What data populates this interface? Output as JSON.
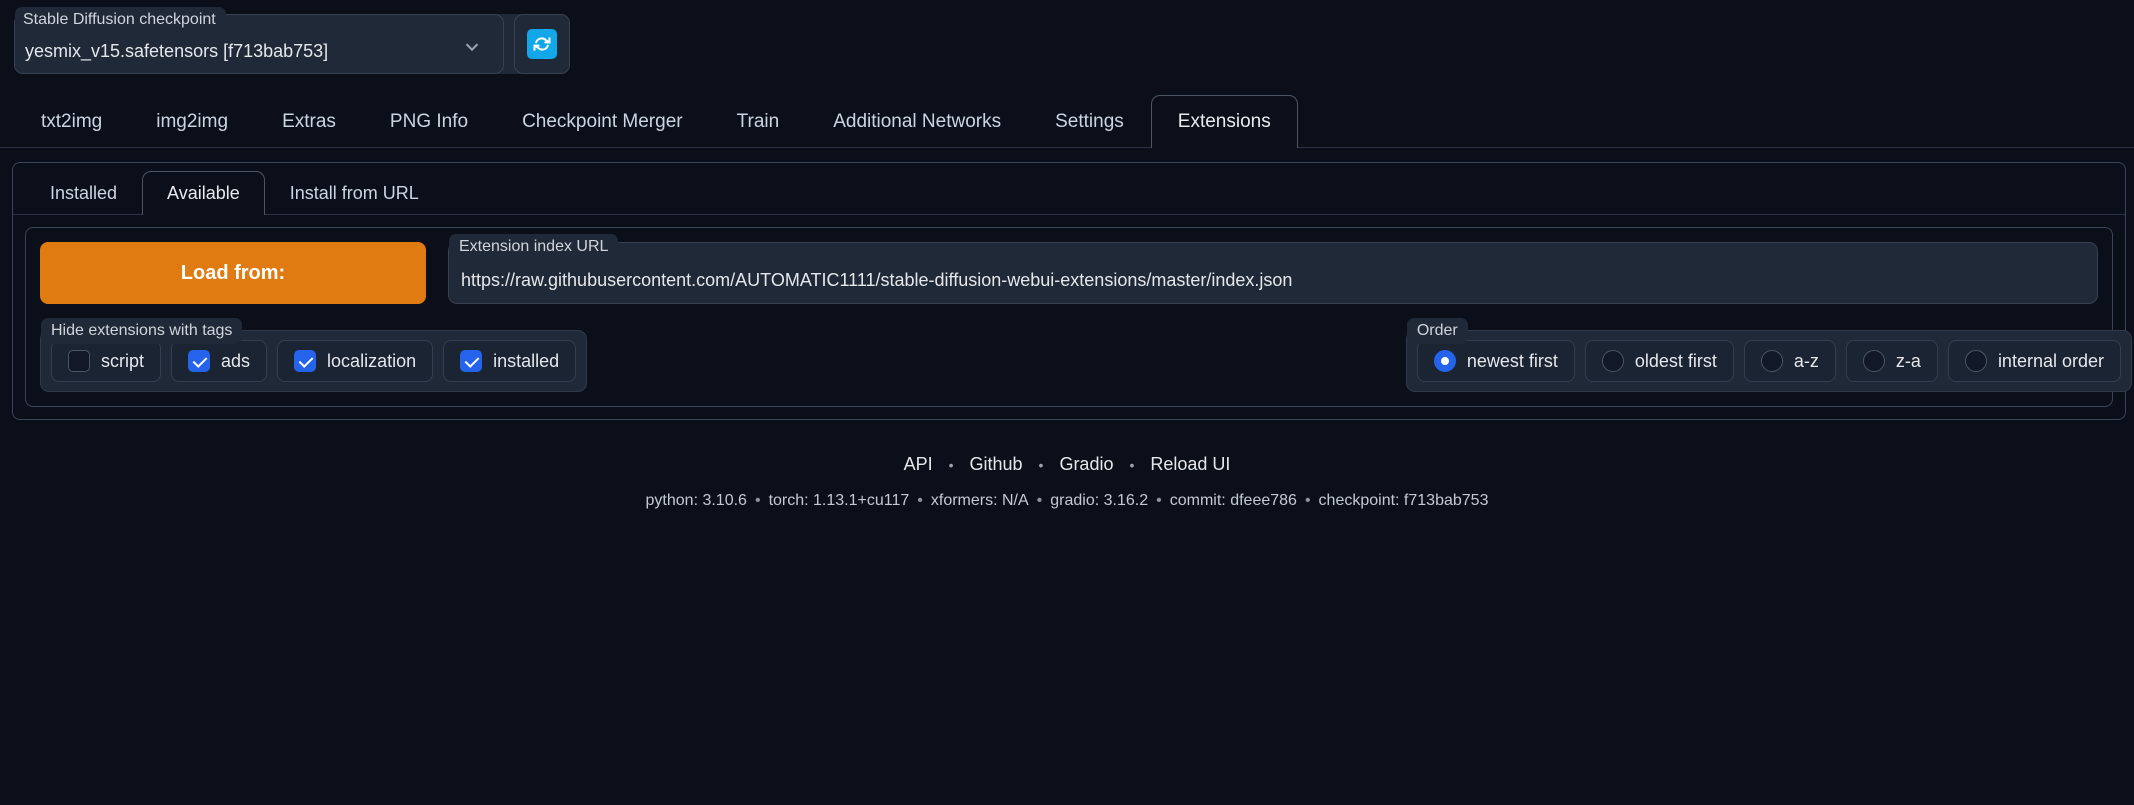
{
  "checkpoint": {
    "label": "Stable Diffusion checkpoint",
    "value": "yesmix_v15.safetensors [f713bab753]",
    "chevron": "chevron-down-icon",
    "refresh_icon": "↻"
  },
  "main_tabs": [
    {
      "label": "txt2img",
      "active": false
    },
    {
      "label": "img2img",
      "active": false
    },
    {
      "label": "Extras",
      "active": false
    },
    {
      "label": "PNG Info",
      "active": false
    },
    {
      "label": "Checkpoint Merger",
      "active": false
    },
    {
      "label": "Train",
      "active": false
    },
    {
      "label": "Additional Networks",
      "active": false
    },
    {
      "label": "Settings",
      "active": false
    },
    {
      "label": "Extensions",
      "active": true
    }
  ],
  "sub_tabs": [
    {
      "label": "Installed",
      "active": false
    },
    {
      "label": "Available",
      "active": true
    },
    {
      "label": "Install from URL",
      "active": false
    }
  ],
  "load": {
    "button_label": "Load from:",
    "url_label": "Extension index URL",
    "url_value": "https://raw.githubusercontent.com/AUTOMATIC1111/stable-diffusion-webui-extensions/master/index.json"
  },
  "hide_tags": {
    "label": "Hide extensions with tags",
    "options": [
      {
        "label": "script",
        "checked": false
      },
      {
        "label": "ads",
        "checked": true
      },
      {
        "label": "localization",
        "checked": true
      },
      {
        "label": "installed",
        "checked": true
      }
    ]
  },
  "order": {
    "label": "Order",
    "options": [
      {
        "label": "newest first",
        "selected": true
      },
      {
        "label": "oldest first",
        "selected": false
      },
      {
        "label": "a-z",
        "selected": false
      },
      {
        "label": "z-a",
        "selected": false
      },
      {
        "label": "internal order",
        "selected": false
      }
    ]
  },
  "footer": {
    "links": [
      "API",
      "Github",
      "Gradio",
      "Reload UI"
    ],
    "separator": "•",
    "versions": [
      "python: 3.10.6",
      "torch: 1.13.1+cu117",
      "xformers: N/A",
      "gradio: 3.16.2",
      "commit: dfeee786",
      "checkpoint: f713bab753"
    ]
  },
  "colors": {
    "accent_orange": "#e07b11",
    "accent_blue": "#2563eb",
    "refresh_blue": "#12a7e8",
    "background": "#0b0f19"
  }
}
